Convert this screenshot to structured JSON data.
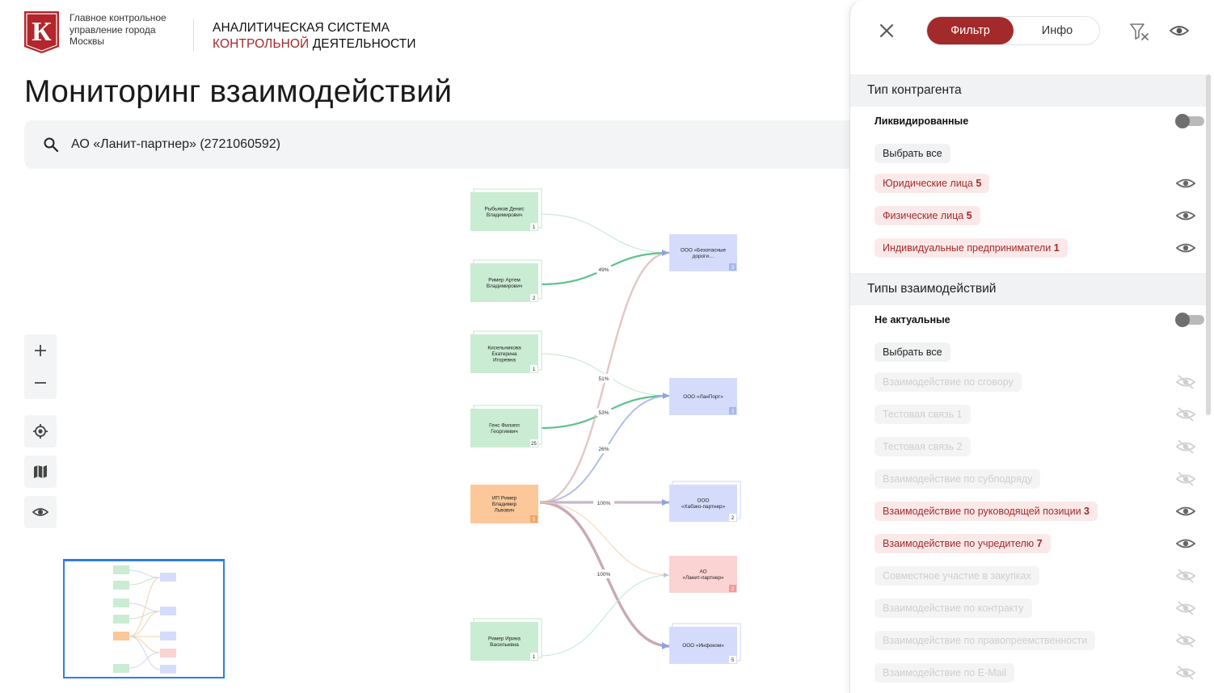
{
  "header": {
    "org_name": "Главное контрольное управление города Москвы",
    "system_title_line1": "АНАЛИТИЧЕСКАЯ СИСТЕМА",
    "system_title_accent": "КОНТРОЛЬНОЙ",
    "system_title_rest": " ДЕЯТЕЛЬНОСТИ",
    "logo_letter": "К"
  },
  "page": {
    "title": "Мониторинг взаимодействий"
  },
  "search": {
    "value": "АО «Ланит-партнер» (2721060592)",
    "icon": "search-icon"
  },
  "tools": {
    "zoom_in": "plus-icon",
    "zoom_out": "minus-icon",
    "center": "target-icon",
    "map": "map-icon",
    "visibility": "eye-icon"
  },
  "graph": {
    "left_nodes": [
      {
        "id": "L1",
        "label": "Рыбьяков Денис Владимирович",
        "count": "1",
        "kind": "person"
      },
      {
        "id": "L2",
        "label": "Ример Артем Владимирович",
        "count": "2",
        "kind": "person"
      },
      {
        "id": "L3",
        "label": "Кисельникова Екатерина Игоревна",
        "count": "1",
        "kind": "person"
      },
      {
        "id": "L4",
        "label": "Генс Филипп Георгиевич",
        "count": "25",
        "kind": "person"
      },
      {
        "id": "L5",
        "label": "ИП Ример Владимир Львович",
        "count": "5",
        "kind": "ip"
      },
      {
        "id": "L6",
        "label": "Ример Ирина Васильевна",
        "count": "1",
        "kind": "person"
      }
    ],
    "right_nodes": [
      {
        "id": "R1",
        "label": "ООО «Безопасные дороги…",
        "count": "3",
        "kind": "org"
      },
      {
        "id": "R2",
        "label": "ООО «ЛанПорт»",
        "count": "3",
        "kind": "org"
      },
      {
        "id": "R3",
        "label": "ООО «Хабэко-партнер»",
        "count": "2",
        "kind": "org-stack"
      },
      {
        "id": "R4",
        "label": "АО «Ланит-партнер»",
        "count": "2",
        "kind": "target"
      },
      {
        "id": "R5",
        "label": "ООО «Инфоком»",
        "count": "5",
        "kind": "org-stack"
      }
    ],
    "edge_labels": [
      "49%",
      "51%",
      "53%",
      "26%",
      "100%",
      "100%"
    ]
  },
  "panel": {
    "tabs": {
      "filter": "Фильтр",
      "info": "Инфо"
    },
    "section1": {
      "title": "Тип контрагента",
      "toggle_label": "Ликвидированные",
      "select_all": "Выбрать все",
      "items": [
        {
          "label": "Юридические лица",
          "count": "5",
          "state": "active"
        },
        {
          "label": "Физические лица",
          "count": "5",
          "state": "active"
        },
        {
          "label": "Индивидуальные предприниматели",
          "count": "1",
          "state": "active"
        }
      ]
    },
    "section2": {
      "title": "Типы взаимодействий",
      "toggle_label": "Не актуальные",
      "select_all": "Выбрать все",
      "items": [
        {
          "label": "Взаимодействие по сговору",
          "count": "",
          "state": "disabled"
        },
        {
          "label": "Тестовая связь 1",
          "count": "",
          "state": "disabled"
        },
        {
          "label": "Тестовая связь 2",
          "count": "",
          "state": "disabled"
        },
        {
          "label": "Взаимодействие по субподряду",
          "count": "",
          "state": "disabled"
        },
        {
          "label": "Взаимодействие по руководящей позиции",
          "count": "3",
          "state": "active"
        },
        {
          "label": "Взаимодействие по учредителю",
          "count": "7",
          "state": "active"
        },
        {
          "label": "Совместное участие в закупках",
          "count": "",
          "state": "disabled"
        },
        {
          "label": "Взаимодействие по контракту",
          "count": "",
          "state": "disabled"
        },
        {
          "label": "Взаимодействие по правопреемственности",
          "count": "",
          "state": "disabled"
        },
        {
          "label": "Взаимодействие по E-Mail",
          "count": "",
          "state": "disabled"
        }
      ]
    }
  },
  "colors": {
    "accent": "#a32a2a",
    "person_node": "#c9ecd3",
    "ip_node": "#fcc899",
    "org_node": "#d5dcfb",
    "target_node": "#fbd3d3",
    "edge_green": "#5cc28a",
    "edge_blue": "#8fa2e6",
    "edge_orange": "#f0b07c"
  }
}
